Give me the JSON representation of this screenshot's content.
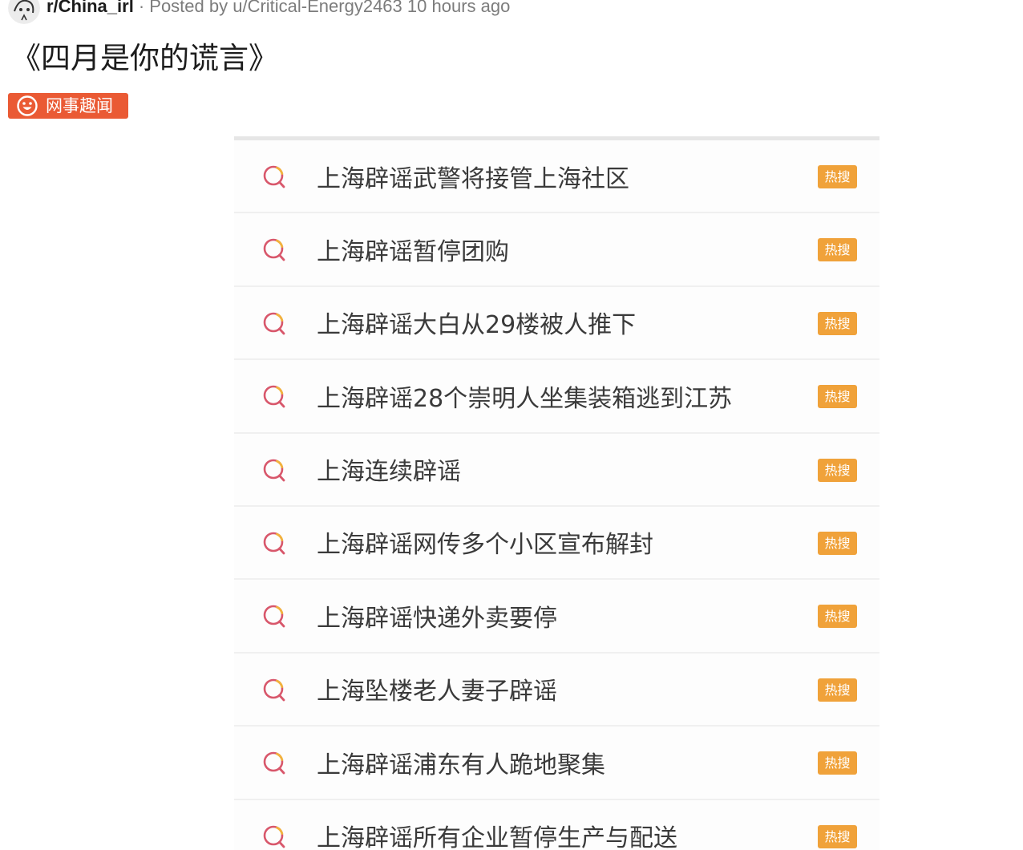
{
  "header": {
    "subreddit": "r/China_irl",
    "separator": "·",
    "posted_by_label": "Posted by",
    "author": "u/Critical-Energy2463",
    "time": "10 hours ago",
    "avatar_icon": "subreddit-avatar"
  },
  "post": {
    "title": "《四月是你的谎言》",
    "flair": {
      "label": "网事趣闻",
      "icon": "smiley-icon",
      "color": "#ea5a34"
    }
  },
  "image": {
    "row_icon": "search-icon",
    "badge_color": "#f0a23a",
    "rows": [
      {
        "text": "上海辟谣武警将接管上海社区",
        "badge": "热搜"
      },
      {
        "text": "上海辟谣暂停团购",
        "badge": "热搜"
      },
      {
        "text": "上海辟谣大白从29楼被人推下",
        "badge": "热搜"
      },
      {
        "text": "上海辟谣28个崇明人坐集装箱逃到江苏",
        "badge": "热搜"
      },
      {
        "text": "上海连续辟谣",
        "badge": "热搜"
      },
      {
        "text": "上海辟谣网传多个小区宣布解封",
        "badge": "热搜"
      },
      {
        "text": "上海辟谣快递外卖要停",
        "badge": "热搜"
      },
      {
        "text": "上海坠楼老人妻子辟谣",
        "badge": "热搜"
      },
      {
        "text": "上海辟谣浦东有人跪地聚集",
        "badge": "热搜"
      },
      {
        "text": "上海辟谣所有企业暂停生产与配送",
        "badge": "热搜"
      }
    ]
  }
}
